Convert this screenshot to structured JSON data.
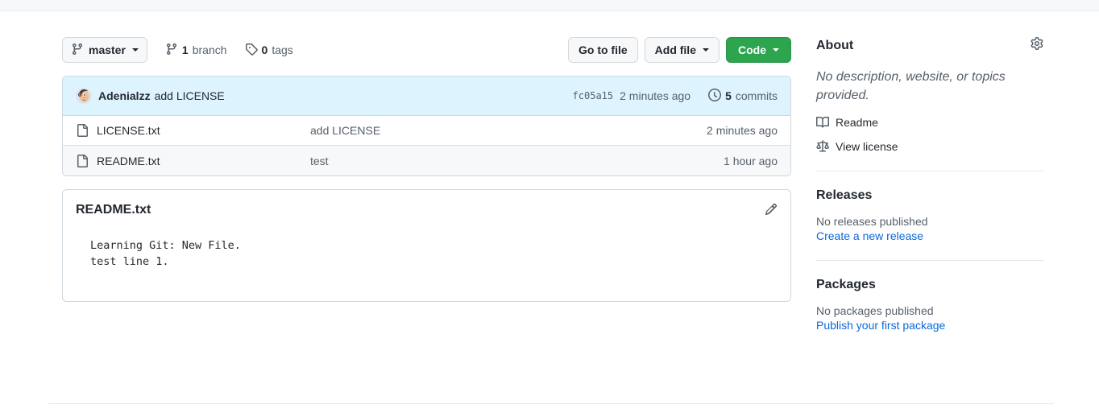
{
  "toolbar": {
    "branch_label": "master",
    "branch_icon": "branch-icon",
    "branches_count": "1",
    "branches_label": "branch",
    "tags_count": "0",
    "tags_label": "tags",
    "go_to_file_label": "Go to file",
    "add_file_label": "Add file",
    "code_label": "Code",
    "code_button_color": "#2da44e"
  },
  "commit_bar": {
    "author": "Adenialzz",
    "message": "add LICENSE",
    "sha": "fc05a15",
    "time": "2 minutes ago",
    "commits_count": "5",
    "commits_label": "commits",
    "background_color": "#ddf4ff"
  },
  "files": [
    {
      "icon": "file-icon",
      "name": "LICENSE.txt",
      "message": "add LICENSE",
      "time": "2 minutes ago"
    },
    {
      "icon": "file-icon",
      "name": "README.txt",
      "message": "test",
      "time": "1 hour ago"
    }
  ],
  "readme": {
    "title": "README.txt",
    "edit_icon": "pencil-icon",
    "content": "Learning Git: New File.\ntest line 1."
  },
  "sidebar": {
    "about": {
      "title": "About",
      "settings_icon": "gear-icon",
      "description": "No description, website, or topics provided.",
      "links": [
        {
          "icon": "book-icon",
          "label": "Readme"
        },
        {
          "icon": "law-icon",
          "label": "View license"
        }
      ]
    },
    "releases": {
      "title": "Releases",
      "empty_text": "No releases published",
      "action_label": "Create a new release",
      "link_color": "#0969da"
    },
    "packages": {
      "title": "Packages",
      "empty_text": "No packages published",
      "action_label": "Publish your first package",
      "link_color": "#0969da"
    }
  }
}
